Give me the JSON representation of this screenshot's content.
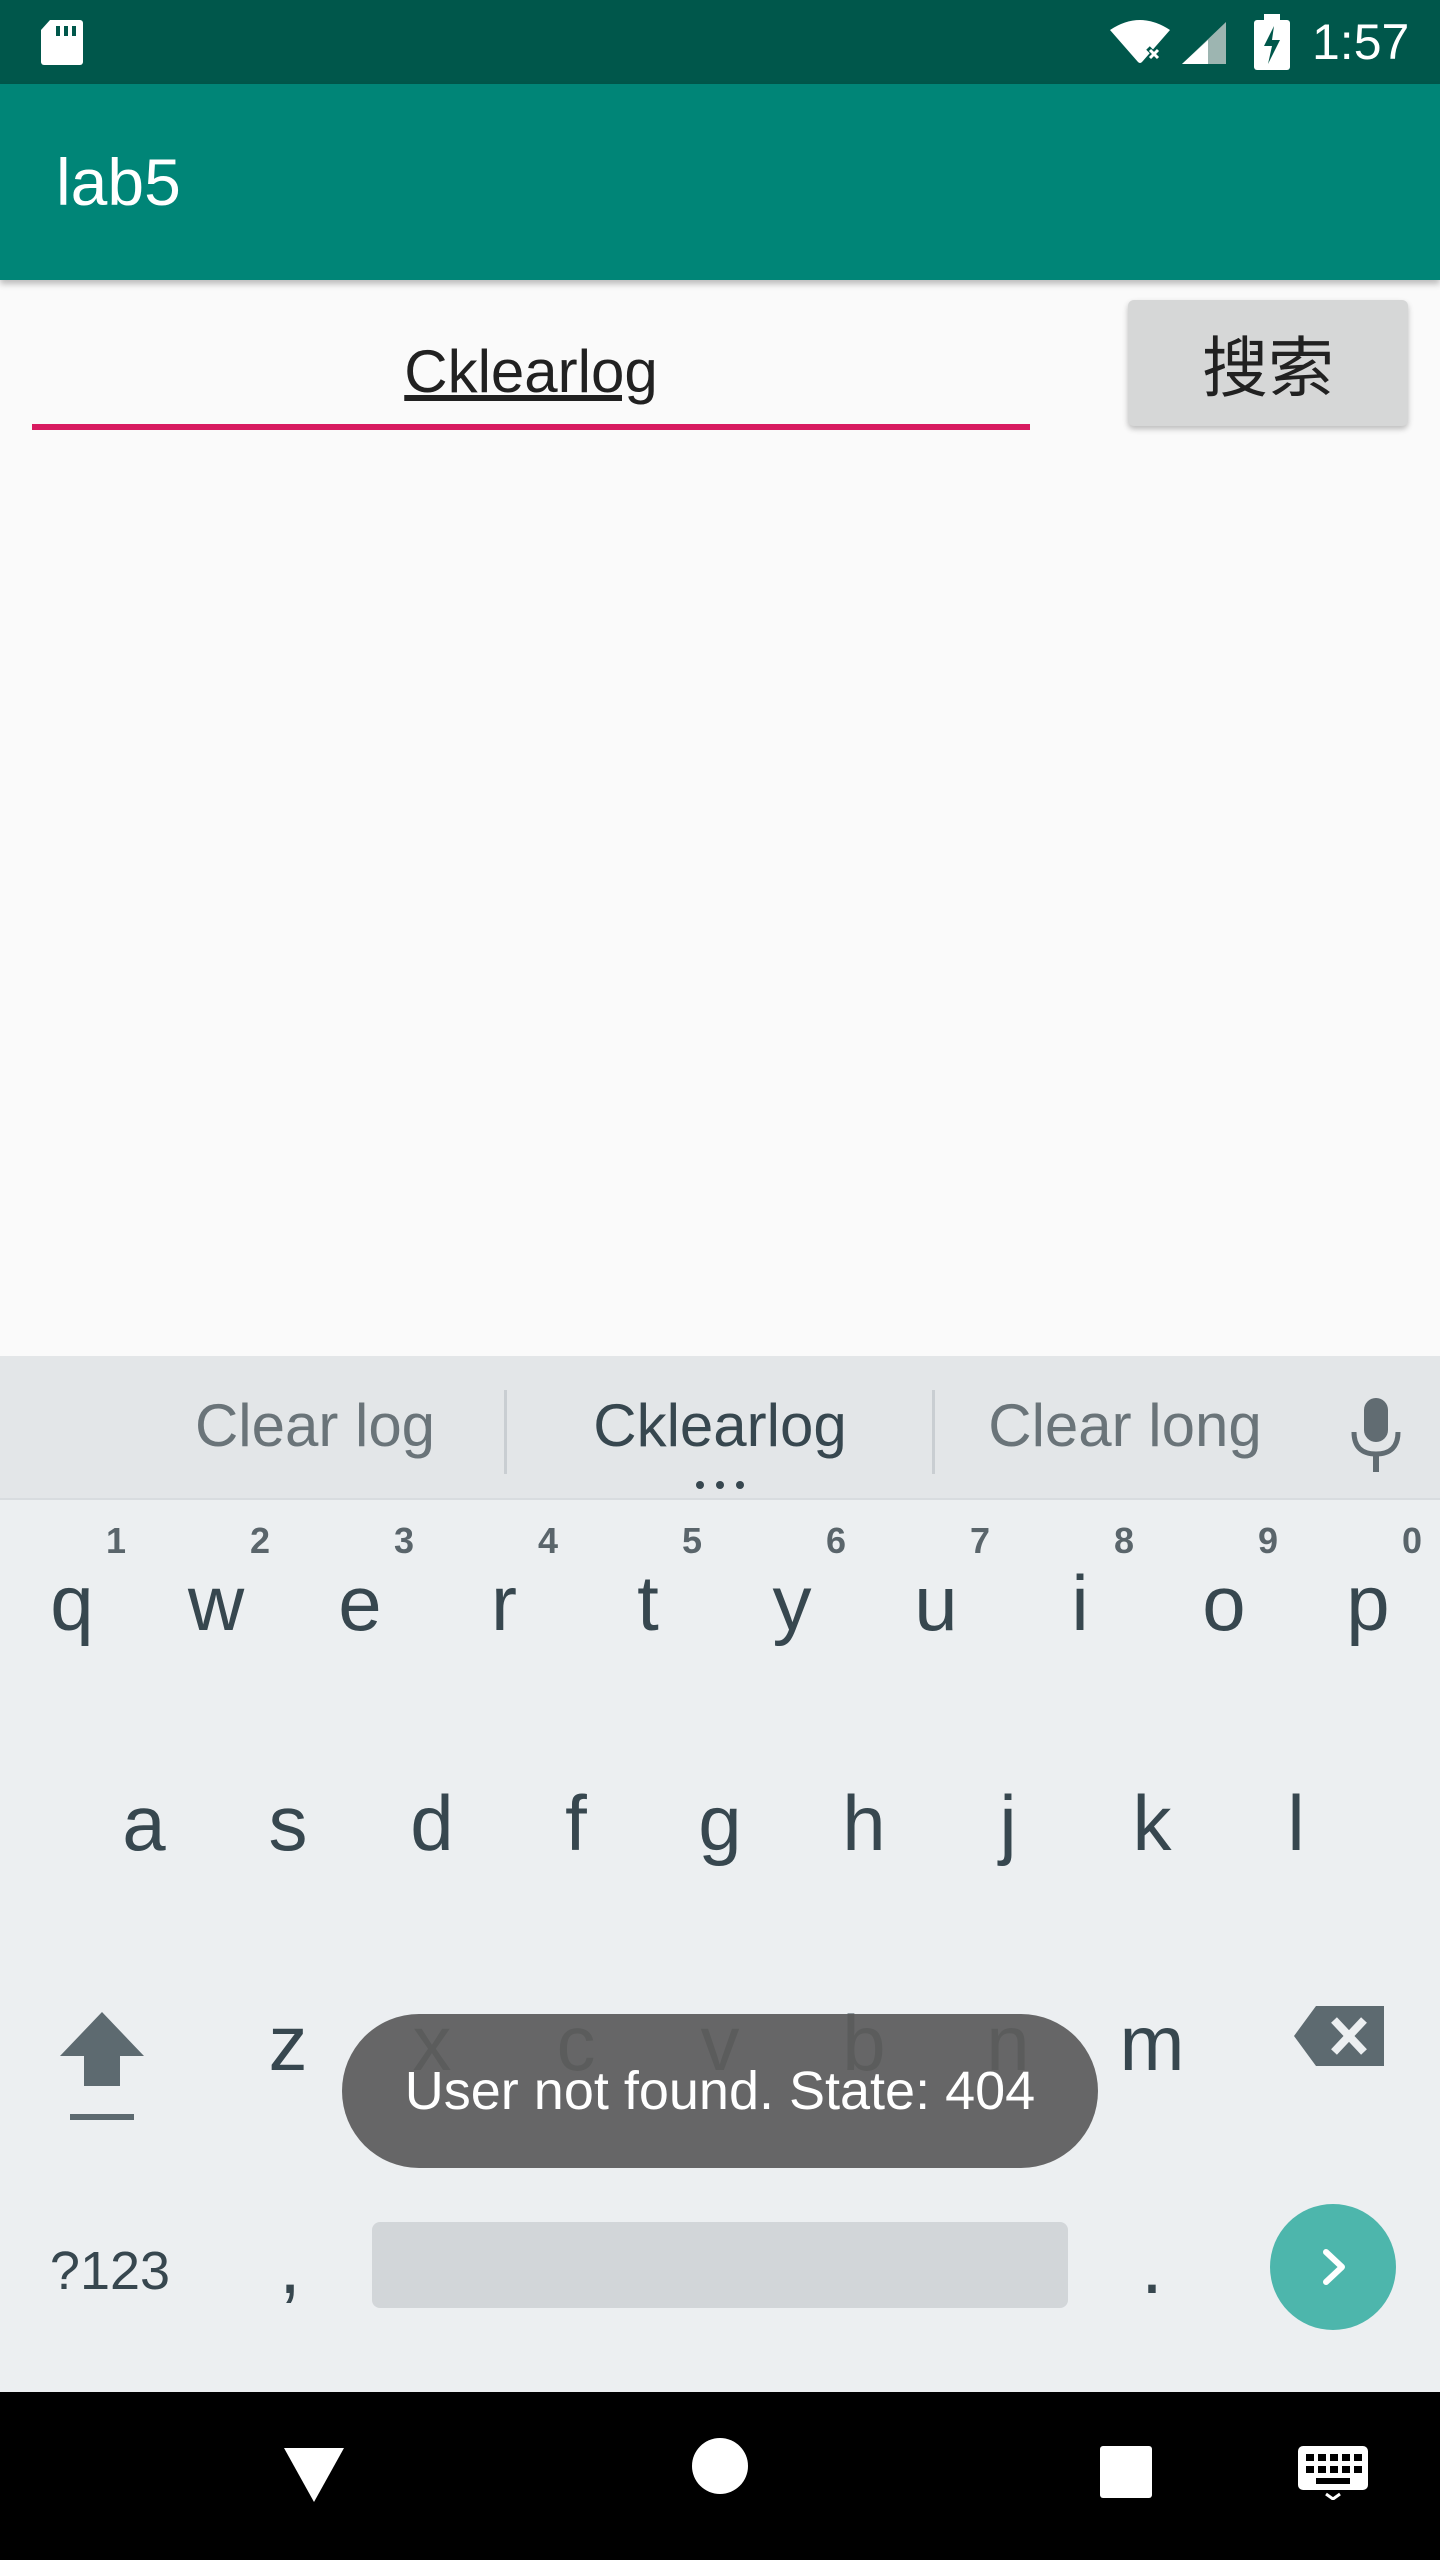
{
  "status_bar": {
    "time": "1:57",
    "icons": [
      "sd-card-icon",
      "wifi-off-icon",
      "cellular-signal-icon",
      "battery-charging-icon"
    ]
  },
  "app_bar": {
    "title": "lab5"
  },
  "search": {
    "input_value": "Cklearlog",
    "button_label": "搜索"
  },
  "keyboard": {
    "suggestions": [
      "Clear log",
      "Cklearlog",
      "Clear long"
    ],
    "rows": [
      [
        {
          "k": "q",
          "h": "1"
        },
        {
          "k": "w",
          "h": "2"
        },
        {
          "k": "e",
          "h": "3"
        },
        {
          "k": "r",
          "h": "4"
        },
        {
          "k": "t",
          "h": "5"
        },
        {
          "k": "y",
          "h": "6"
        },
        {
          "k": "u",
          "h": "7"
        },
        {
          "k": "i",
          "h": "8"
        },
        {
          "k": "o",
          "h": "9"
        },
        {
          "k": "p",
          "h": "0"
        }
      ],
      [
        {
          "k": "a"
        },
        {
          "k": "s"
        },
        {
          "k": "d"
        },
        {
          "k": "f"
        },
        {
          "k": "g"
        },
        {
          "k": "h"
        },
        {
          "k": "j"
        },
        {
          "k": "k"
        },
        {
          "k": "l"
        }
      ],
      [
        {
          "k": "z"
        },
        {
          "k": "x"
        },
        {
          "k": "c"
        },
        {
          "k": "v"
        },
        {
          "k": "b"
        },
        {
          "k": "n"
        },
        {
          "k": "m"
        }
      ]
    ],
    "numbers_label": "?123",
    "comma_label": ",",
    "period_label": "."
  },
  "toast": {
    "message": "User not found. State: 404"
  },
  "colors": {
    "status_bar": "#00574b",
    "app_bar": "#008577",
    "accent": "#d81b60",
    "keyboard_bg": "#eceff1",
    "go_key": "#4db6ac"
  }
}
